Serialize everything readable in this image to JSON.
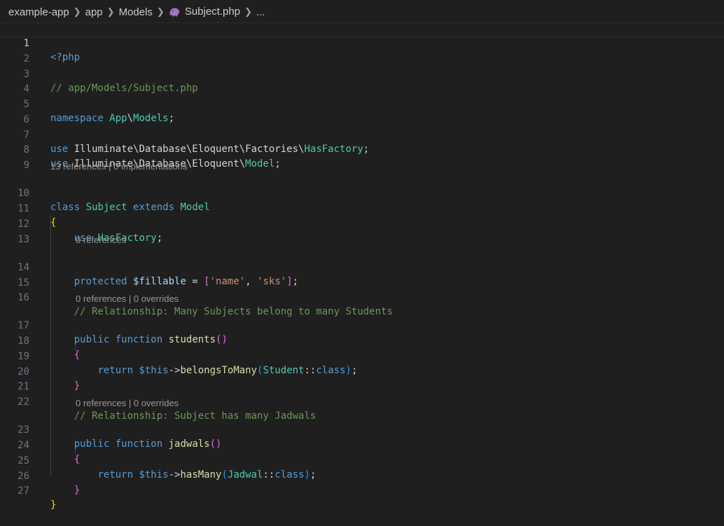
{
  "breadcrumb": {
    "items": [
      "example-app",
      "app",
      "Models",
      "Subject.php",
      "..."
    ]
  },
  "editor": {
    "active_line": 1,
    "line_numbers": [
      "1",
      "2",
      "3",
      "4",
      "5",
      "6",
      "7",
      "8",
      "9",
      "10",
      "11",
      "12",
      "13",
      "14",
      "15",
      "16",
      "17",
      "18",
      "19",
      "20",
      "21",
      "22",
      "23",
      "24",
      "25",
      "26",
      "27"
    ],
    "code_lens": {
      "class_refs": "13 references | 0 implementations",
      "fillable_refs": "0 references",
      "students_refs": "0 references | 0 overrides",
      "jadwals_refs": "0 references | 0 overrides"
    },
    "lines": {
      "l1": {
        "open_tag": "<?php"
      },
      "l3": {
        "comment": "// app/Models/Subject.php"
      },
      "l5": {
        "kw": "namespace",
        "ns1": "App",
        "sep": "\\",
        "ns2": "Models",
        "semi": ";"
      },
      "l7": {
        "kw": "use",
        "path": "Illuminate\\Database\\Eloquent\\Factories\\",
        "cls": "HasFactory",
        "semi": ";"
      },
      "l8": {
        "kw": "use",
        "path": "Illuminate\\Database\\Eloquent\\",
        "cls": "Model",
        "semi": ";"
      },
      "l10": {
        "kw1": "class",
        "name": "Subject",
        "kw2": "extends",
        "parent": "Model"
      },
      "l11": {
        "brace": "{"
      },
      "l12": {
        "kw": "use",
        "trait": "HasFactory",
        "semi": ";"
      },
      "l14": {
        "kw": "protected",
        "var": "$fillable",
        "eq": " = ",
        "open": "[",
        "s1": "'name'",
        "comma": ", ",
        "s2": "'sks'",
        "close": "]",
        "semi": ";"
      },
      "l16": {
        "comment": "// Relationship: Many Subjects belong to many Students"
      },
      "l17": {
        "kw1": "public",
        "kw2": "function",
        "fn": "students",
        "parens": "()"
      },
      "l18": {
        "brace": "{"
      },
      "l19": {
        "kw": "return",
        "this": "$this",
        "arrow": "->",
        "method": "belongsToMany",
        "open": "(",
        "cls": "Student",
        "dc": "::",
        "clskw": "class",
        "close": ")",
        "semi": ";"
      },
      "l20": {
        "brace": "}"
      },
      "l22": {
        "comment": "// Relationship: Subject has many Jadwals"
      },
      "l23": {
        "kw1": "public",
        "kw2": "function",
        "fn": "jadwals",
        "parens": "()"
      },
      "l24": {
        "brace": "{"
      },
      "l25": {
        "kw": "return",
        "this": "$this",
        "arrow": "->",
        "method": "hasMany",
        "open": "(",
        "cls": "Jadwal",
        "dc": "::",
        "clskw": "class",
        "close": ")",
        "semi": ";"
      },
      "l26": {
        "brace": "}"
      },
      "l27": {
        "brace": "}"
      }
    }
  },
  "colors": {
    "background": "#1f1f1f",
    "keyword": "#569cd6",
    "type": "#4ec9b0",
    "comment": "#6a9955",
    "string": "#ce9178",
    "variable": "#9cdcfe",
    "function": "#dcdcaa",
    "bracket_gold": "#ffd700",
    "bracket_orchid": "#da70d6",
    "bracket_blue": "#179fff"
  }
}
